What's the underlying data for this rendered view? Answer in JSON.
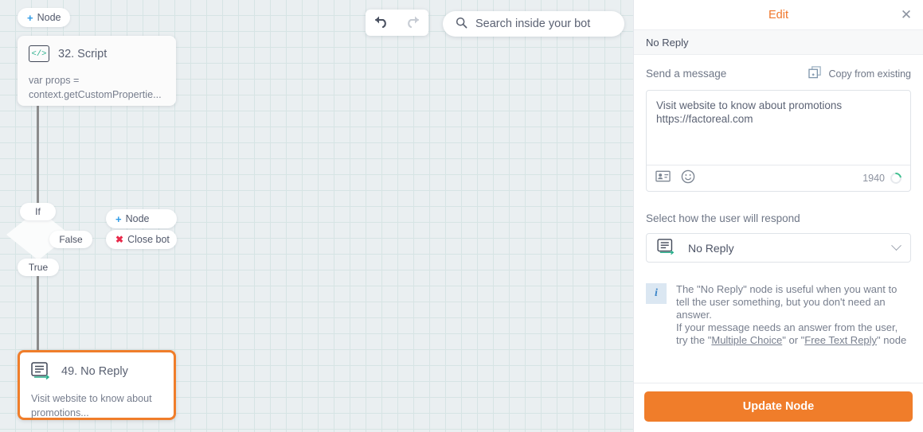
{
  "canvas": {
    "add_node_top": {
      "icon": "plus-icon",
      "label": "Node"
    },
    "add_node_mid": {
      "icon": "plus-icon",
      "label": "Node"
    },
    "close_bot": {
      "icon": "cross-icon",
      "label": "Close bot"
    },
    "branches": {
      "if": "If",
      "false": "False",
      "true": "True"
    },
    "nodes": [
      {
        "icon": "code-icon",
        "icon_glyph": "</>",
        "title": "32. Script",
        "body": "var props = context.getCustomPropertie...",
        "selected": false
      },
      {
        "icon": "no-reply-icon",
        "title": "49. No Reply",
        "body": "Visit website to know about promotions...",
        "selected": true
      }
    ]
  },
  "toolbar": {
    "undo_icon": "undo-icon",
    "redo_icon": "redo-icon",
    "search_icon": "search-icon",
    "search_placeholder": "Search inside your bot"
  },
  "panel": {
    "title": "Edit",
    "close_icon": "close-icon",
    "subtitle": "No Reply",
    "message_section": {
      "label": "Send a message",
      "copy_icon": "copy-icon",
      "copy_label": "Copy from existing",
      "value": "Visit website to know about promotions\nhttps://factoreal.com",
      "attachment_icon": "contact-card-icon",
      "emoji_icon": "smiley-icon",
      "char_count": "1940"
    },
    "respond_section": {
      "label": "Select how the user will respond",
      "selected_icon": "no-reply-icon",
      "selected_value": "No Reply",
      "chevron_icon": "chevron-down-icon"
    },
    "info": {
      "icon": "info-icon",
      "line1": "The \"No Reply\" node is useful when you want to tell the user something, but you don't need an answer.",
      "line2_pre": "If your message needs an answer from the user, try the \"",
      "link1": "Multiple Choice",
      "line2_mid": "\" or \"",
      "link2": "Free Text Reply",
      "line2_post": "\" node"
    },
    "update_label": "Update Node"
  },
  "colors": {
    "accent_orange": "#f07d2a",
    "canvas_bg": "#eaeff1",
    "grid_line": "#d6e4e4",
    "link_blue": "#2e9ae6",
    "close_red": "#e8294a",
    "icon_green": "#27ae8a"
  }
}
